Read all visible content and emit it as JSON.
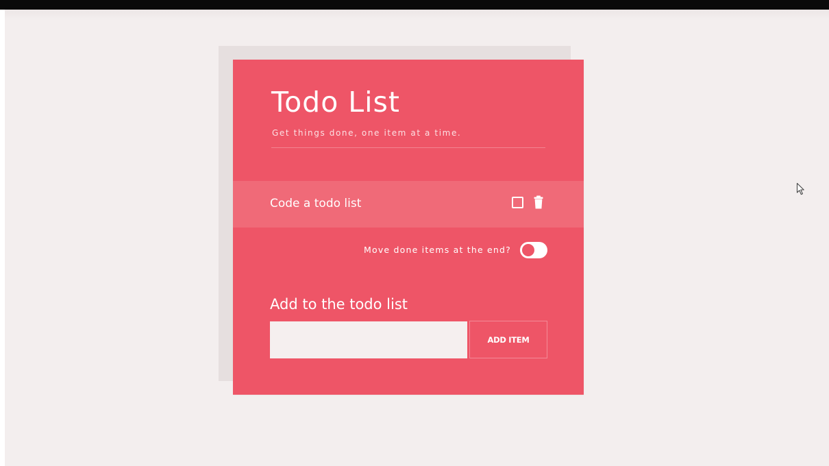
{
  "app": {
    "title": "Todo List",
    "subtitle": "Get things done, one item at a time."
  },
  "todos": [
    {
      "label": "Code a todo list",
      "done": false
    }
  ],
  "toggle": {
    "label": "Move done items at the end?",
    "on": true
  },
  "add_form": {
    "heading": "Add to the todo list",
    "input_value": "",
    "button_label": "ADD ITEM"
  },
  "icons": {
    "item_checkbox": "checkbox-icon",
    "item_delete": "trash-icon",
    "mouse_cursor": "cursor-arrow-icon"
  },
  "colors": {
    "accent": "#ee5567",
    "row_highlight": "#f06a78",
    "page_background": "#f3eeee",
    "backdrop_panel": "#e6dfdf",
    "input_background": "#f5efef"
  }
}
